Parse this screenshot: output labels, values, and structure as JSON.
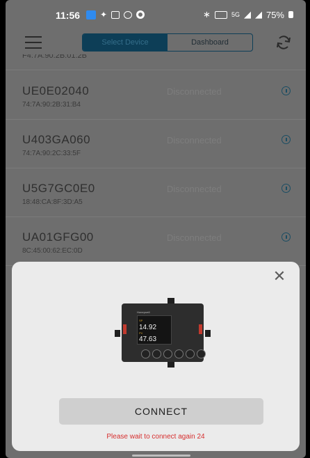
{
  "status_bar": {
    "time": "11:56",
    "right_text": "75%",
    "network": "5G"
  },
  "toolbar": {
    "tabs": [
      {
        "label": "Select Device",
        "selected": true
      },
      {
        "label": "Dashboard",
        "selected": false
      }
    ]
  },
  "devices_cut_off_mac": "F4:7A:90:2B:01:2B",
  "devices": [
    {
      "name": "UE0E02040",
      "mac": "74:7A:90:2B:31:B4",
      "status": "Disconnected"
    },
    {
      "name": "U403GA060",
      "mac": "74:7A:90:2C:33:5F",
      "status": "Disconnected"
    },
    {
      "name": "U5G7GC0E0",
      "mac": "18:48:CA:8F:3D:A5",
      "status": "Disconnected"
    },
    {
      "name": "UA01GFG00",
      "mac": "8C:45:00:62:EC:0D",
      "status": "Disconnected"
    }
  ],
  "sheet": {
    "close_label": "✕",
    "device_image": {
      "brand": "Honeywell",
      "sp_value": "14.92",
      "pv_value": "47.63",
      "sp_tag": "SP",
      "pv_tag": "PV"
    },
    "connect_label": "CONNECT",
    "wait_message": "Please wait to connect again 24"
  },
  "colors": {
    "accent": "#0d3e57",
    "error": "#d62e2e"
  }
}
